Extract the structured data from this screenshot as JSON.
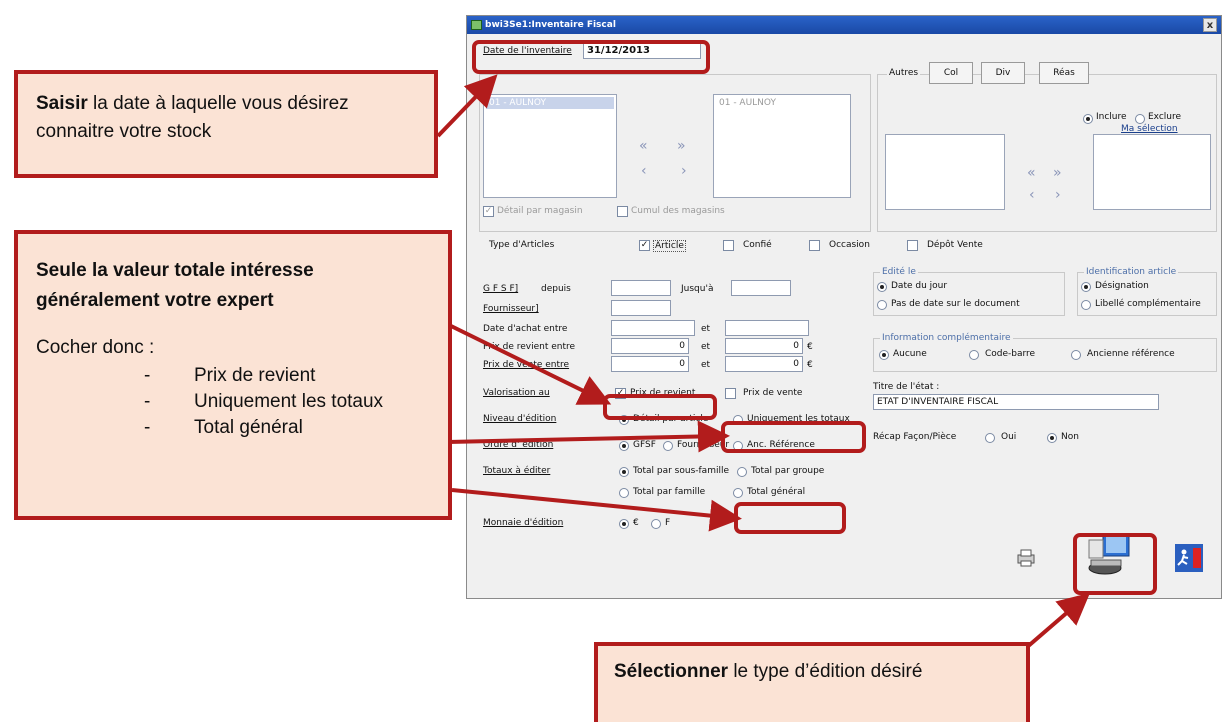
{
  "window": {
    "title": "bwi3Se1:Inventaire Fiscal",
    "close_glyph": "x"
  },
  "date_inventaire": {
    "label": "Date de l'inventaire",
    "value": "31/12/2013"
  },
  "stores": {
    "group_label": "",
    "left_item": "01 - AULNOY",
    "right_item": "01 - AULNOY",
    "detail_par_magasin": "Détail par magasin",
    "cumul_des_magasins": "Cumul des magasins"
  },
  "autres": {
    "label": "Autres",
    "tabs": [
      "Col",
      "Div",
      "Réas"
    ],
    "inclure": "Inclure",
    "exclure": "Exclure",
    "ma_selection": "Ma sélection"
  },
  "type_articles": {
    "label": "Type d'Articles",
    "options": [
      "Article",
      "Confié",
      "Occasion",
      "Dépôt Vente"
    ]
  },
  "filters": {
    "gfsf": "G F S F]",
    "depuis": "depuis",
    "jusqua": "Jusqu'à",
    "fournisseur": "Fournisseur]",
    "date_achat": "Date d'achat entre",
    "prix_revient_entre": "Prix de revient entre",
    "prix_vente_entre": "Prix de vente entre",
    "et": "et",
    "zero": "0",
    "euro": "€"
  },
  "valorisation": {
    "label": "Valorisation au",
    "opt1": "Prix de revient",
    "opt2": "Prix de vente"
  },
  "niveau_edition": {
    "label": "Niveau d'édition",
    "opt1": "Détail par article",
    "opt2": "Uniquement les totaux"
  },
  "ordre_edition": {
    "label": "Ordre d' édition",
    "opt1": "GFSF",
    "opt2": "Fournisseur",
    "opt3": "Anc. Référence"
  },
  "totaux_editer": {
    "label": "Totaux à éditer",
    "opt1": "Total par sous-famille",
    "opt2": "Total par groupe",
    "opt3": "Total par famille",
    "opt4": "Total général"
  },
  "monnaie": {
    "label": "Monnaie d'édition",
    "opt1": "€",
    "opt2": "F"
  },
  "edite_le": {
    "title": "Edité le",
    "opt1": "Date du jour",
    "opt2": "Pas de date sur le document"
  },
  "identification": {
    "title": "Identification article",
    "opt1": "Désignation",
    "opt2": "Libellé complémentaire"
  },
  "info_comp": {
    "title": "Information complémentaire",
    "opt1": "Aucune",
    "opt2": "Code-barre",
    "opt3": "Ancienne référence"
  },
  "titre_etat": {
    "label": "Titre de l'état :",
    "value": "ETAT D'INVENTAIRE FISCAL"
  },
  "recap": {
    "label": "Récap Façon/Pièce",
    "oui": "Oui",
    "non": "Non"
  },
  "annotations": {
    "saisir": {
      "bold": "Saisir",
      "rest": " la date à laquelle vous désirez connaitre votre stock"
    },
    "seule": {
      "bold": "Seule la valeur totale intéresse généralement votre expert",
      "cocher": "Cocher donc :",
      "items": [
        "Prix de revient",
        "Uniquement les totaux",
        "Total général"
      ],
      "dash": "-"
    },
    "selectionner": {
      "bold": "Sélectionner",
      "rest": " le type d’édition désiré"
    }
  },
  "colors": {
    "annotation_red": "#b21c1c",
    "callout_fill": "#fbe3d5",
    "title_blue": "#1a49a6"
  }
}
